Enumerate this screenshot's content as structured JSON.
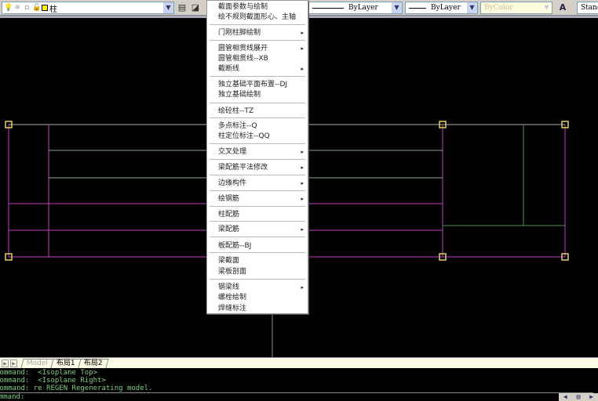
{
  "toolbar": {
    "layer_name": "柱",
    "linetype": "ByLayer",
    "lineweight": "ByLayer",
    "plotstyle": "ByColor",
    "text_style": "Stand",
    "icons": [
      "lightbulb-icon",
      "sun-icon",
      "lock-icon",
      "color-swatch",
      "layer-manager-icon",
      "layer-previous-icon",
      "text-style-icon"
    ],
    "layer_color": "#ffff00"
  },
  "menu": {
    "items": [
      {
        "label": "截面参数与绘制",
        "submenu": false
      },
      {
        "label": "绘不规则截面形心、主轴",
        "submenu": false
      },
      {
        "label": "门刚柱脚绘制",
        "submenu": true
      },
      {
        "label": "圆管相贯线展开",
        "submenu": true
      },
      {
        "label": "圆管相贯线--XB",
        "submenu": false
      },
      {
        "label": "截断线",
        "submenu": true
      },
      {
        "label": "独立基础平面布置--DJ",
        "submenu": false
      },
      {
        "label": "独立基础绘制",
        "submenu": false
      },
      {
        "label": "绘砼柱--TZ",
        "submenu": false
      },
      {
        "label": "多点标注--Q",
        "submenu": false
      },
      {
        "label": "柱定位标注--QQ",
        "submenu": false
      },
      {
        "label": "交叉处理",
        "submenu": true
      },
      {
        "label": "梁配筋平法修改",
        "submenu": true
      },
      {
        "label": "边缘构件",
        "submenu": true
      },
      {
        "label": "绘钢筋",
        "submenu": true
      },
      {
        "label": "柱配筋",
        "submenu": false
      },
      {
        "label": "梁配筋",
        "submenu": true
      },
      {
        "label": "板配筋--BJ",
        "submenu": false
      },
      {
        "label": "梁截面",
        "submenu": false
      },
      {
        "label": "梁板剖面",
        "submenu": false
      },
      {
        "label": "钢梁线",
        "submenu": true
      },
      {
        "label": "螺栓绘制",
        "submenu": false
      },
      {
        "label": "焊缝标注",
        "submenu": false
      }
    ],
    "submenu_arrow": "▸"
  },
  "tabs": [
    "Model",
    "布局1",
    "布局2"
  ],
  "command": {
    "history": [
      "Command:  <Isoplane Top>",
      "Command:  <Isoplane Right>",
      "Command: re REGEN Regenerating model."
    ],
    "prompt": "Command:"
  },
  "colors": {
    "magenta": "#c040c0",
    "green": "#4a9a4a",
    "gray": "#b0b0b0",
    "grip": "#e8d060"
  }
}
